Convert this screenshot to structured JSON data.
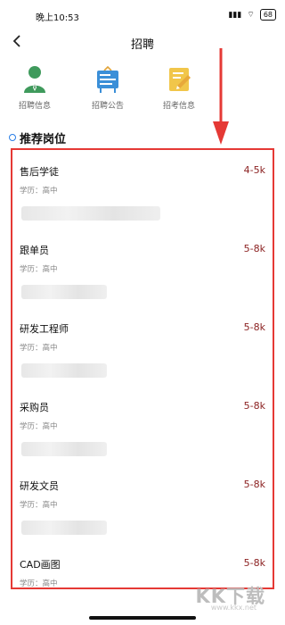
{
  "status_bar": {
    "time": "晚上10:53",
    "signal": "▮▮▮",
    "wifi": "⌔",
    "battery": "68"
  },
  "nav": {
    "title": "招聘"
  },
  "quick_links": [
    {
      "label": "招聘信息",
      "icon": "person-icon"
    },
    {
      "label": "招聘公告",
      "icon": "bulletin-board-icon"
    },
    {
      "label": "招考信息",
      "icon": "exam-note-icon"
    }
  ],
  "section": {
    "title": "推荐岗位"
  },
  "jobs": [
    {
      "title": "售后学徒",
      "salary": "4-5k",
      "education": "学历：高中"
    },
    {
      "title": "跟单员",
      "salary": "5-8k",
      "education": "学历：高中"
    },
    {
      "title": "研发工程师",
      "salary": "5-8k",
      "education": "学历：高中"
    },
    {
      "title": "采购员",
      "salary": "5-8k",
      "education": "学历：高中"
    },
    {
      "title": "研发文员",
      "salary": "5-8k",
      "education": "学历：高中"
    },
    {
      "title": "CAD画图",
      "salary": "5-8k",
      "education": "学历：高中"
    }
  ],
  "watermark": {
    "brand": "KK下载",
    "url": "www.kkx.net"
  },
  "colors": {
    "highlight_border": "#e53935",
    "salary": "#8a1f1f",
    "accent": "#2a7ee6"
  }
}
